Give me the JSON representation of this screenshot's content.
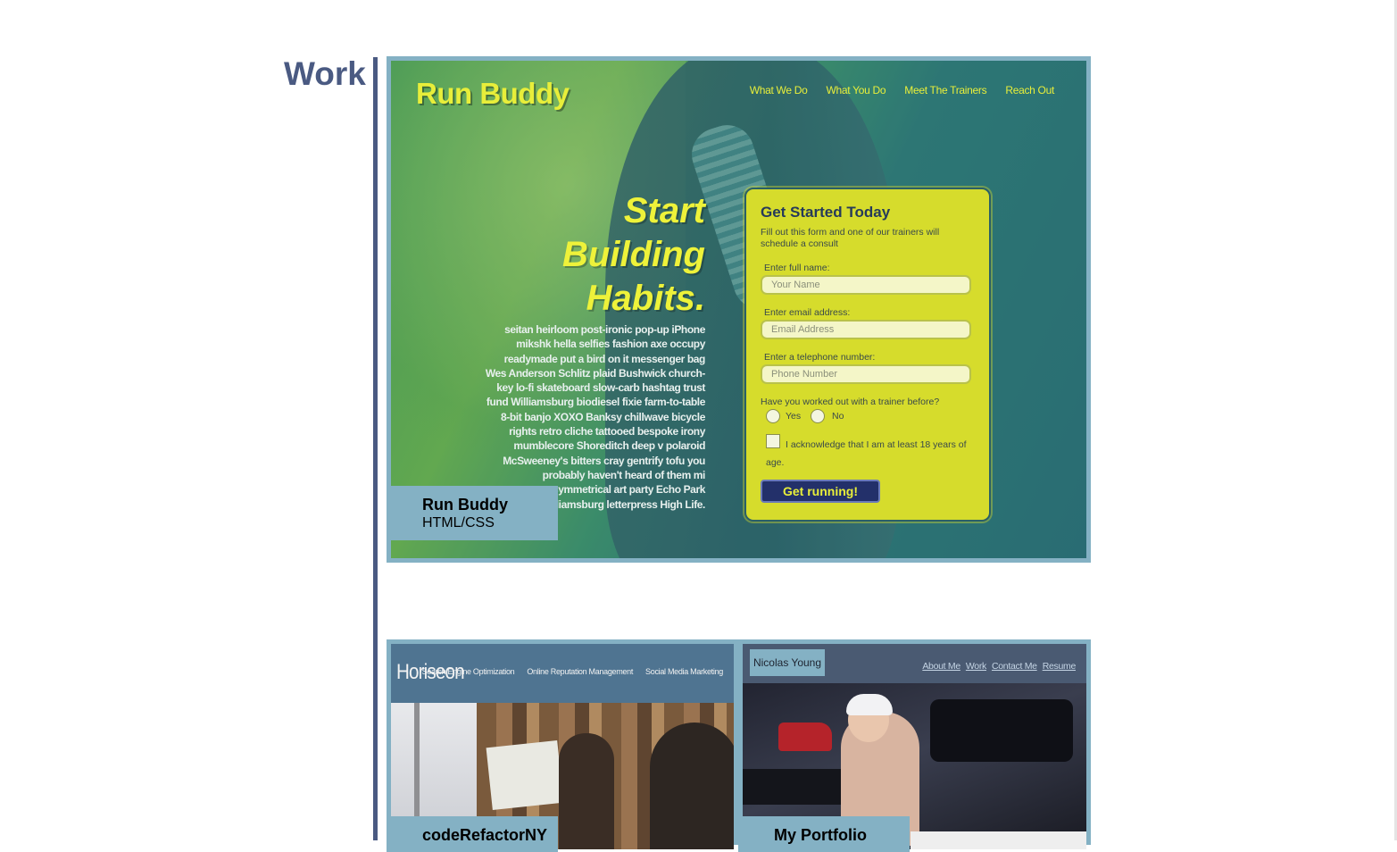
{
  "section": {
    "title": "Work"
  },
  "projects": [
    {
      "title": "Run Buddy",
      "tech": "HTML/CSS",
      "preview": {
        "logo": "Run Buddy",
        "nav": [
          "What We Do",
          "What You Do",
          "Meet The Trainers",
          "Reach Out"
        ],
        "headline": [
          "Start",
          "Building",
          "Habits."
        ],
        "body": "seitan heirloom post-ironic pop-up iPhone mikshk hella selfies fashion axe occupy readymade put a bird on it messenger bag Wes Anderson Schlitz plaid Bushwick church-key lo-fi skateboard slow-carb hashtag trust fund Williamsburg biodiesel fixie farm-to-table 8-bit banjo XOXO Banksy chillwave bicycle rights retro cliche tattooed bespoke irony mumblecore Shoreditch deep v polaroid McSweeney's bitters cray gentrify tofu you probably haven't heard of them mi asymmetrical art party Echo Park Williamsburg letterpress High Life.",
        "form": {
          "title": "Get Started Today",
          "subtitle": "Fill out this form and one of our trainers will schedule a consult",
          "name_label": "Enter full name:",
          "name_placeholder": "Your Name",
          "email_label": "Enter email address:",
          "email_placeholder": "Email Address",
          "phone_label": "Enter a telephone number:",
          "phone_placeholder": "Phone Number",
          "trainer_question": "Have you worked out with a trainer before?",
          "yes": "Yes",
          "no": "No",
          "acknowledge": "I acknowledge that I am at least 18 years of age.",
          "submit": "Get running!"
        }
      }
    },
    {
      "title": "codeRefactorNY",
      "preview": {
        "logo": "Horiseon",
        "nav": [
          "Search Engine Optimization",
          "Online Reputation Management",
          "Social Media Marketing"
        ]
      }
    },
    {
      "title": "My Portfolio",
      "preview": {
        "name": "Nicolas Young",
        "nav": [
          "About Me",
          "Work",
          "Contact Me",
          "Resume"
        ]
      }
    }
  ],
  "colors": {
    "accent": "#4a5a82",
    "caption_bg": "#84b1c4",
    "runbuddy_yellow": "#e8ee3a"
  }
}
